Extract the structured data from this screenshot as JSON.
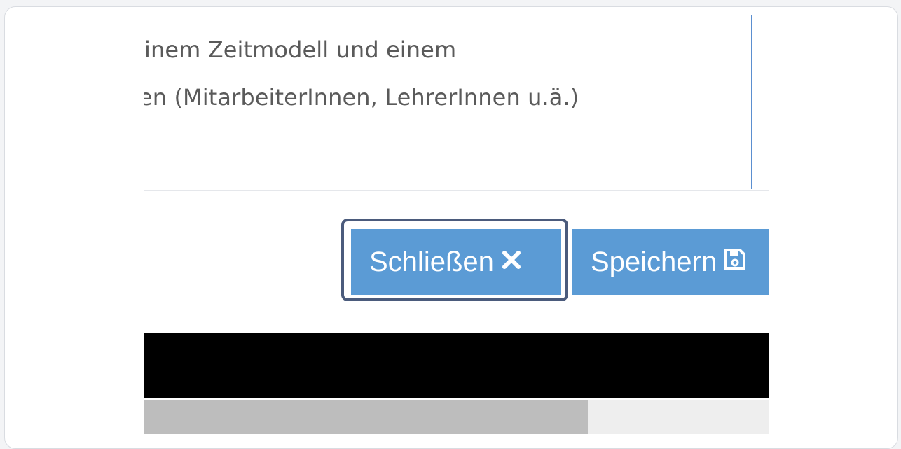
{
  "description": {
    "line1": "inem Zeitmodell und einem",
    "line2": "en (MitarbeiterInnen, LehrerInnen u.ä.)"
  },
  "buttons": {
    "close_label": "Schließen",
    "close_icon": "times-icon",
    "save_label": "Speichern",
    "save_icon": "floppy-disk-icon"
  },
  "colors": {
    "button_bg": "#5b9bd5",
    "focus_ring": "#4b5b7c",
    "divider_blue": "#5b8fd0",
    "text": "#5a5a5a"
  },
  "scrollbar": {
    "thumb_fraction": 0.71
  }
}
